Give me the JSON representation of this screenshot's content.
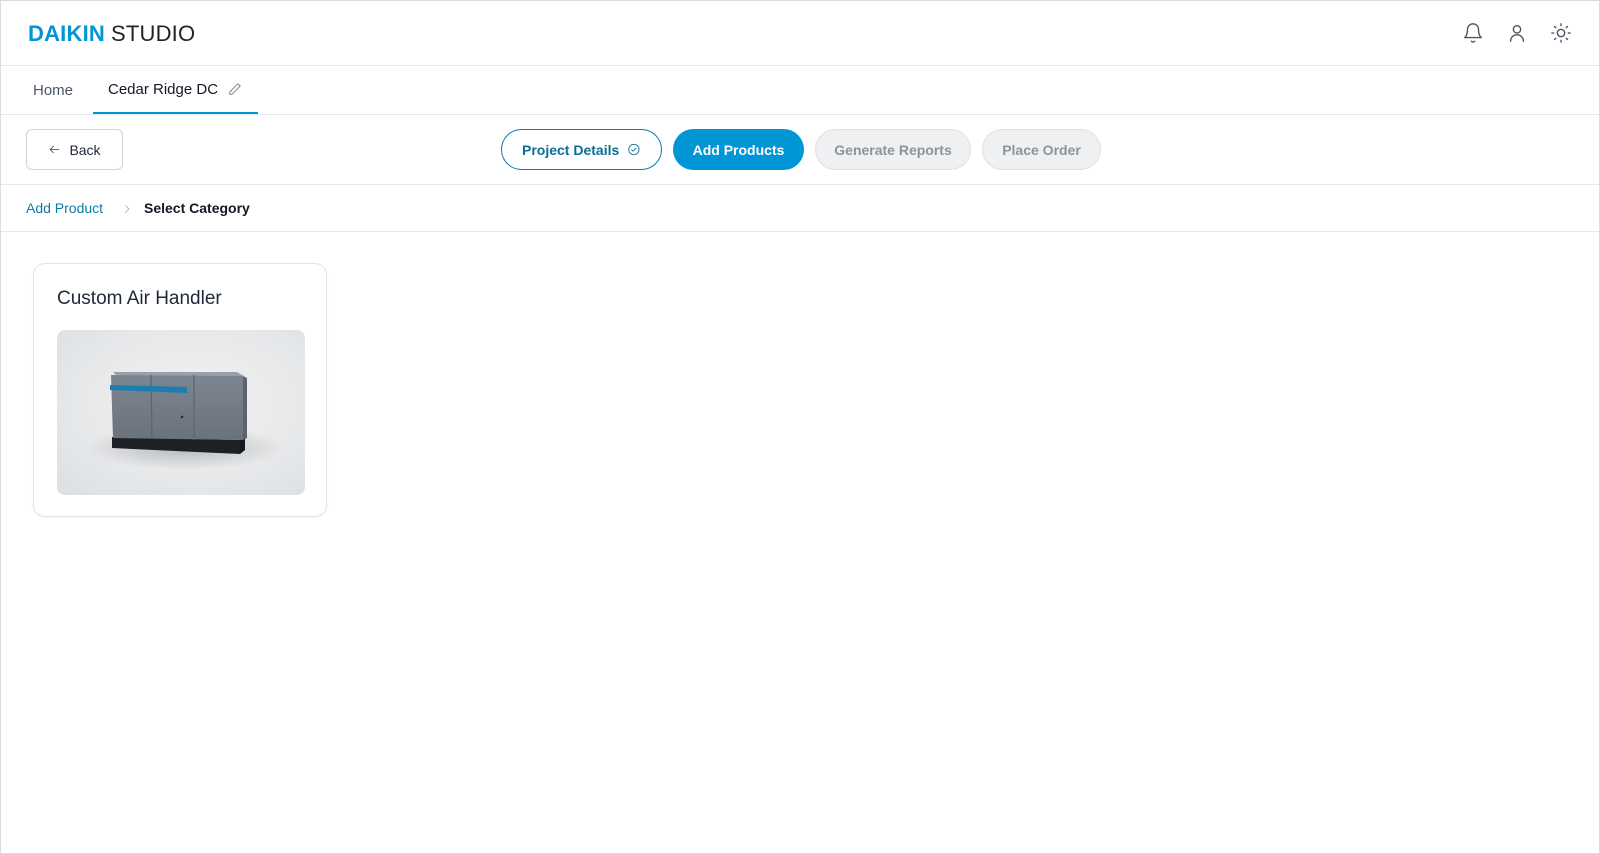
{
  "header": {
    "brand_primary": "DAIKIN",
    "brand_secondary": "STUDIO",
    "brand_color": "#0096d6",
    "icons": [
      "bell-icon",
      "user-icon",
      "sun-icon"
    ]
  },
  "tabs": {
    "home_label": "Home",
    "project_label": "Cedar Ridge DC",
    "project_edit_icon": "pencil-icon"
  },
  "toolbar": {
    "back_label": "Back",
    "steps": [
      {
        "label": "Project Details",
        "state": "done"
      },
      {
        "label": "Add Products",
        "state": "active"
      },
      {
        "label": "Generate Reports",
        "state": "disabled"
      },
      {
        "label": "Place Order",
        "state": "disabled"
      }
    ],
    "accent_color": "#0096d6"
  },
  "breadcrumb": {
    "parent": "Add Product",
    "current": "Select Category"
  },
  "products": [
    {
      "title": "Custom Air Handler",
      "image": "air-handler-illustration"
    }
  ]
}
